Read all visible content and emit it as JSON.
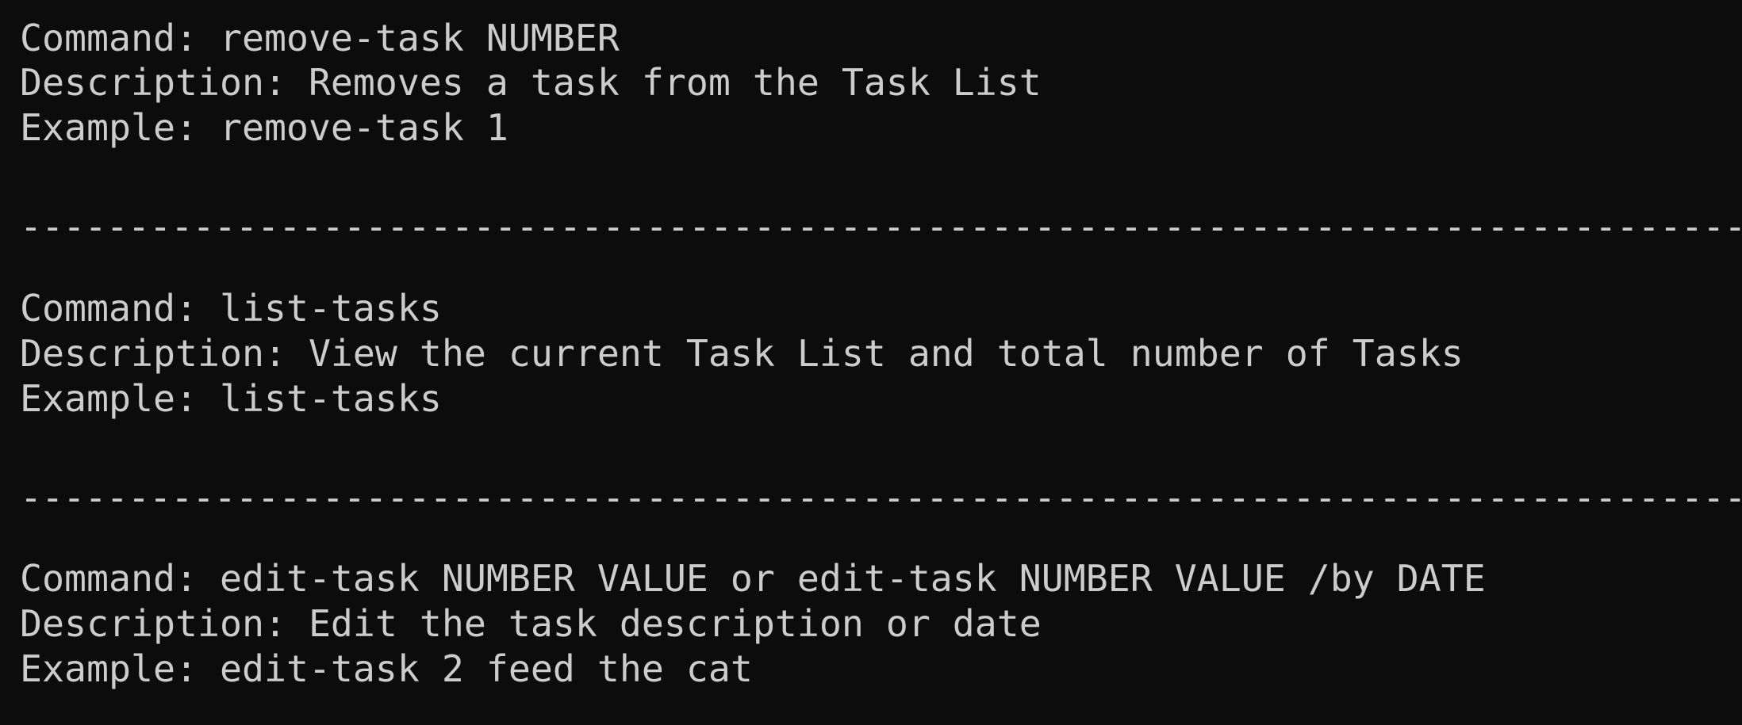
{
  "terminal": {
    "blocks": [
      {
        "command": "Command: remove-task NUMBER",
        "description": "Description: Removes a task from the Task List",
        "example": "Example: remove-task 1"
      },
      {
        "command": "Command: list-tasks",
        "description": "Description: View the current Task List and total number of Tasks",
        "example": "Example: list-tasks"
      },
      {
        "command": "Command: edit-task NUMBER VALUE or edit-task NUMBER VALUE /by DATE",
        "description": "Description: Edit the task description or date",
        "example": "Example: edit-task 2 feed the cat"
      }
    ],
    "separator": "--------------------------------------------------------------------------------"
  }
}
